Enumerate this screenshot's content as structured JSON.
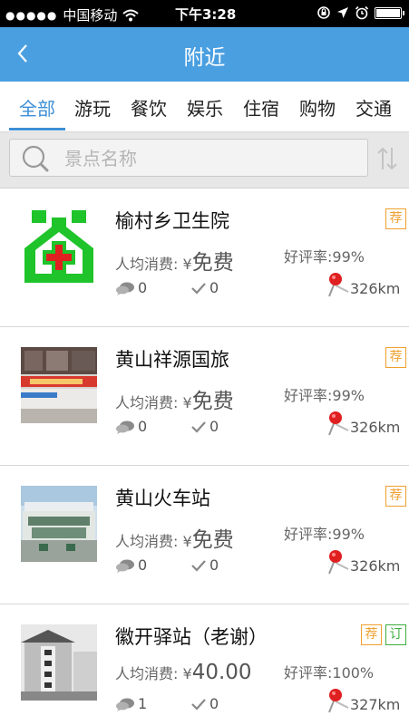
{
  "status_bar": {
    "signal_dots": "●●●●●",
    "carrier": "中国移动",
    "time": "下午3:28",
    "icons": [
      "wifi-icon",
      "rotation-lock-icon",
      "location-arrow-icon",
      "alarm-icon",
      "battery-icon"
    ]
  },
  "nav": {
    "back_label": "<",
    "title": "附近"
  },
  "tabs": [
    {
      "label": "全部",
      "active": true
    },
    {
      "label": "游玩"
    },
    {
      "label": "餐饮"
    },
    {
      "label": "娱乐"
    },
    {
      "label": "住宿"
    },
    {
      "label": "购物"
    },
    {
      "label": "交通"
    }
  ],
  "search": {
    "placeholder": "景点名称",
    "value": ""
  },
  "items": [
    {
      "name": "榆村乡卫生院",
      "price_label": "人均消费:",
      "currency": "¥",
      "price": "免费",
      "rating": "好评率:99%",
      "comments": "0",
      "likes": "0",
      "distance": "326km",
      "badges": [
        "荐"
      ],
      "thumb": "hospital-logo"
    },
    {
      "name": "黄山祥源国旅",
      "price_label": "人均消费:",
      "currency": "¥",
      "price": "免费",
      "rating": "好评率:99%",
      "comments": "0",
      "likes": "0",
      "distance": "326km",
      "badges": [
        "荐"
      ],
      "thumb": "bus-photo"
    },
    {
      "name": "黄山火车站",
      "price_label": "人均消费:",
      "currency": "¥",
      "price": "免费",
      "rating": "好评率:99%",
      "comments": "0",
      "likes": "0",
      "distance": "326km",
      "badges": [
        "荐"
      ],
      "thumb": "station-photo"
    },
    {
      "name": "徽开驿站（老谢）",
      "price_label": "人均消费:",
      "currency": "¥",
      "price": "40.00",
      "rating": "好评率:100%",
      "comments": "1",
      "likes": "0",
      "distance": "327km",
      "badges": [
        "荐",
        "订"
      ],
      "thumb": "inn-photo"
    }
  ],
  "colors": {
    "nav_bg": "#4a9fe1",
    "tab_active": "#3d8fd6",
    "badge_recommend": "#f0a030",
    "badge_book": "#3fae3f",
    "hospital_green": "#1fc32a",
    "pin_red": "#e02020"
  }
}
